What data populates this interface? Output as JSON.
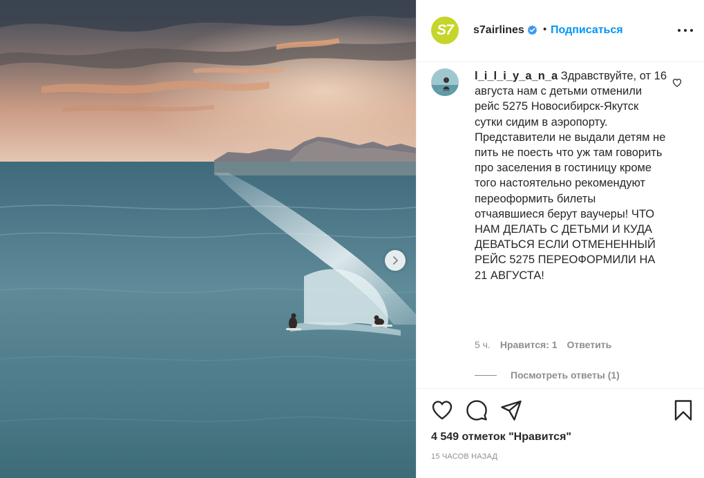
{
  "post": {
    "next_icon": "chevron-right-icon"
  },
  "header": {
    "logo_text": "S7",
    "username": "s7airlines",
    "verified_icon": "verified-badge-icon",
    "separator": "•",
    "follow_label": "Подписаться",
    "more_icon": "more-horizontal-icon"
  },
  "comment": {
    "username": "l_i_l_i_y_a_n_a",
    "text": "Здравствуйте, от 16 августа нам с детьми отменили рейс 5275 Новосибирск-Якутск сутки сидим в аэропорту. Представители не выдали детям не пить не поесть что уж там говорить про заселения в гостиницу кроме того настоятельно рекомендуют переоформить билеты отчаявшиеся берут ваучеры! ЧТО НАМ ДЕЛАТЬ С ДЕТЬМИ И КУДА ДЕВАТЬСЯ ЕСЛИ ОТМЕНЕННЫЙ РЕЙС 5275 ПЕРЕОФОРМИЛИ НА 21 АВГУСТА!",
    "age": "5 ч.",
    "likes": "Нравится: 1",
    "reply_label": "Ответить",
    "view_replies": "Посмотреть ответы (1)"
  },
  "actions": {
    "icons": [
      "heart-icon",
      "comment-icon",
      "share-icon",
      "bookmark-icon"
    ]
  },
  "likes_text": "4 549 отметок \"Нравится\"",
  "posted_ago": "15 часов назад",
  "colors": {
    "accent": "#0095f6",
    "brand": "#c5d52a",
    "muted": "#8e8e8e",
    "text": "#262626"
  }
}
